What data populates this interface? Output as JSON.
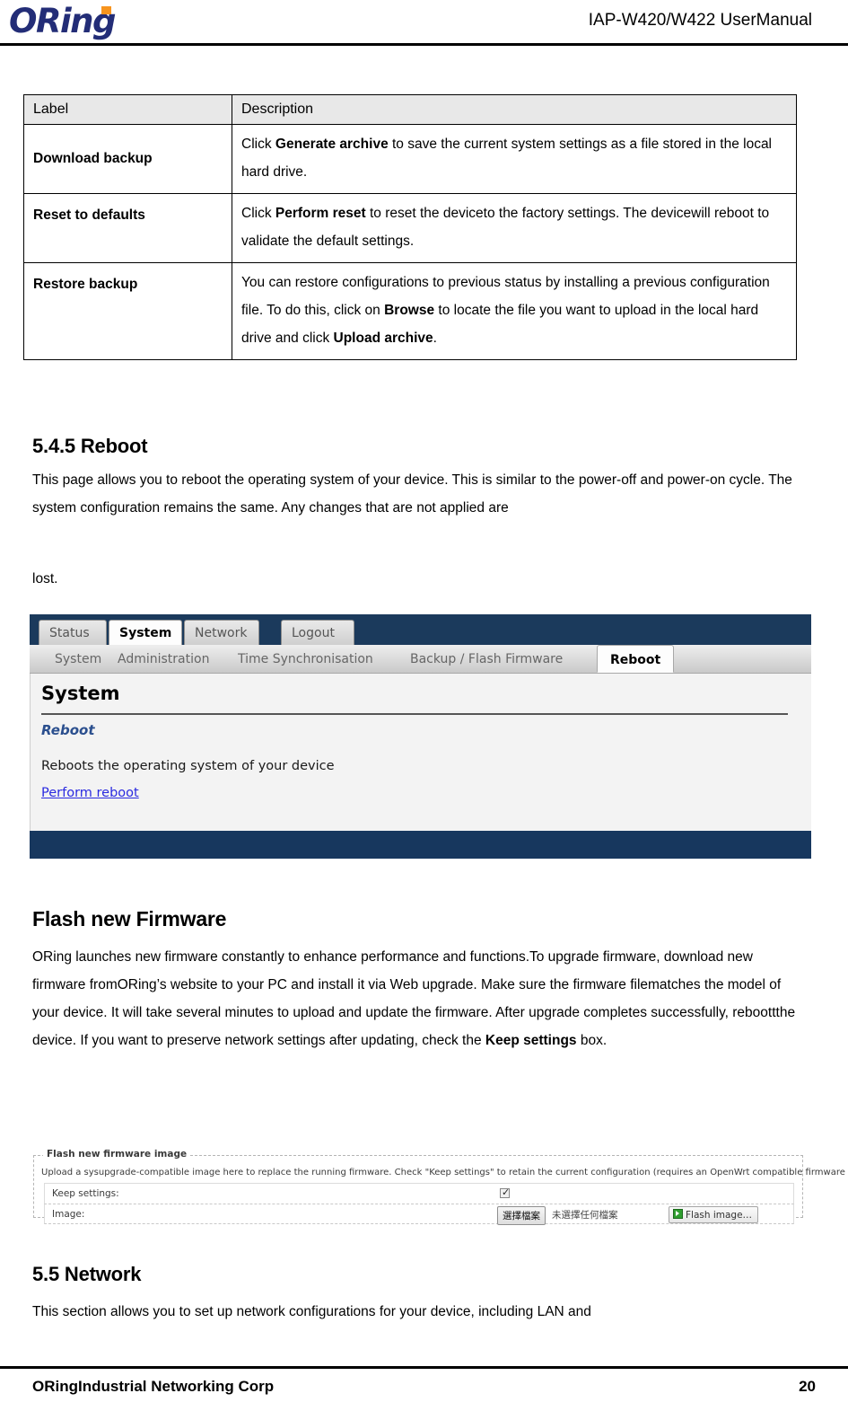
{
  "header": {
    "logo_text": "ORing",
    "logo_color": "#232d77",
    "logo_dot_color": "#f7941e",
    "title": "IAP-W420/W422  UserManual"
  },
  "table": {
    "columns": [
      "Label",
      "Description"
    ],
    "rows": [
      {
        "label": "Download backup",
        "description_parts": [
          {
            "text": "Click ",
            "bold": false
          },
          {
            "text": "Generate archive",
            "bold": true
          },
          {
            "text": " to save the current system settings as a file stored in the local hard drive.",
            "bold": false
          }
        ],
        "description_plain": "Click Generate archive to save the current system settings as a file stored in the local hard drive."
      },
      {
        "label": "Reset to defaults",
        "description_parts": [
          {
            "text": "Click ",
            "bold": false
          },
          {
            "text": "Perform reset",
            "bold": true
          },
          {
            "text": " to reset the deviceto the factory settings. The devicewill reboot to validate the default settings.",
            "bold": false
          }
        ],
        "description_plain": "Click Perform reset to reset the deviceto the factory settings. The devicewill reboot to validate the default settings."
      },
      {
        "label": "Restore backup",
        "description_parts": [
          {
            "text": "You can restore configurations to previous status by installing a previous configuration file. To do this, click on ",
            "bold": false
          },
          {
            "text": "Browse",
            "bold": true
          },
          {
            "text": " to locate the file you want to upload in the local hard drive and click ",
            "bold": false
          },
          {
            "text": "Upload archive",
            "bold": true
          },
          {
            "text": ".",
            "bold": false
          }
        ],
        "description_plain": "You can restore configurations to previous status by installing a previous configuration file. To do this, click on Browse to locate the file you want to upload in the local hard drive and click Upload archive."
      }
    ]
  },
  "section_reboot": {
    "heading": "5.4.5 Reboot",
    "paragraph": "This page allows you to reboot the operating system of your device. This is similar to the power-off and power-on cycle. The system configuration remains the same. Any changes that are not applied are",
    "paragraph_tail": "lost."
  },
  "ui_reboot": {
    "top_tabs": [
      {
        "label": "Status",
        "active": false
      },
      {
        "label": "System",
        "active": true
      },
      {
        "label": "Network",
        "active": false
      },
      {
        "label": "Logout",
        "active": false
      }
    ],
    "sub_tabs": [
      {
        "label": "System",
        "active": false
      },
      {
        "label": "Administration",
        "active": false
      },
      {
        "label": "Time Synchronisation",
        "active": false
      },
      {
        "label": "Backup / Flash Firmware",
        "active": false
      },
      {
        "label": "Reboot",
        "active": true
      }
    ],
    "page_title": "System",
    "panel_title": "Reboot",
    "panel_text": "Reboots the operating system of your device",
    "action_link": "Perform reboot",
    "topbar_color": "#1b3a5c",
    "bottombar_color": "#17375e",
    "link_color": "#2a2ae0",
    "panel_title_color": "#2b4f8e"
  },
  "section_firmware": {
    "heading": "Flash new Firmware",
    "paragraph_parts": [
      {
        "text": "ORing launches new firmware constantly to enhance performance and functions.To upgrade firmware, download new firmware fromORing’s website to your PC and install it via Web upgrade. Make sure the firmware filematches the model of your device. It will take several minutes to upload and update the firmware. After upgrade completes successfully, reboottthe device. If you want to preserve network settings after updating, check the ",
        "bold": false
      },
      {
        "text": "Keep settings",
        "bold": true
      },
      {
        "text": " box.",
        "bold": false
      }
    ],
    "paragraph_plain": "ORing launches new firmware constantly to enhance performance and functions.To upgrade firmware, download new firmware fromORing’s website to your PC and install it via Web upgrade. Make sure the firmware filematches the model of your device. It will take several minutes to upload and update the firmware. After upgrade completes successfully, rebootthe device. If you want to preserve network settings after updating, check the Keep settings box."
  },
  "ui_firmware": {
    "legend": "Flash new firmware image",
    "description": "Upload a sysupgrade-compatible image here to replace the running firmware. Check \"Keep settings\" to retain the current configuration (requires an OpenWrt compatible firmware image).",
    "rows": [
      {
        "label": "Keep settings:",
        "checked": true
      },
      {
        "label": "Image:"
      }
    ],
    "file_button": "選擇檔案",
    "file_status": "未選擇任何檔案",
    "flash_button": "Flash image…"
  },
  "section_network": {
    "heading": "5.5 Network",
    "paragraph": "This section allows you to set up network configurations for your device, including LAN and"
  },
  "footer": {
    "company": "ORingIndustrial Networking Corp",
    "page_number": "20"
  }
}
